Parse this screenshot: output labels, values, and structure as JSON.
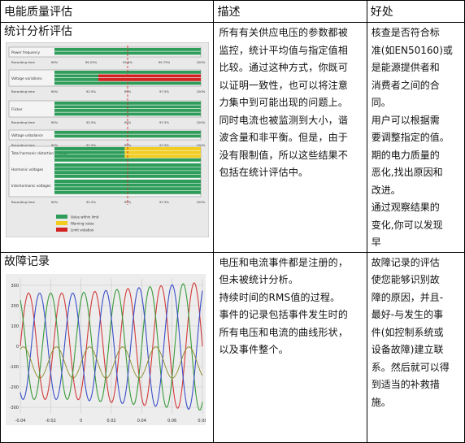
{
  "headers": {
    "col1": "电能质量评估",
    "col2": "描述",
    "col3": "好处"
  },
  "rows": [
    {
      "title": "统计分析评估",
      "description": [
        "所有有关供应电压的参数都被",
        "监控，统计平均值与指定值相",
        "比较。通过这种方式，你既可",
        "以证明一致性，也可以将注意",
        "力集中到可能出现的问题上。",
        "同时电流也被监测到大小，谐",
        "波含量和非平衡。但是，由于",
        "没有限制值，所以这些结果不",
        "包括在统计评估中。"
      ],
      "benefit": [
        "核查是否符合标",
        "准(如EN50160)或",
        "是能源提供者和",
        "消费者之间的合",
        "同。",
        "用户可以根据需",
        "要调整指定的值。",
        "期的电力质量的",
        "恶化,找出原因和",
        "改进。",
        "通过观察结果的",
        "变化,你可以发现",
        "早"
      ]
    },
    {
      "title": "故障记录",
      "description": [
        "电压和电流事件都是注册的，",
        "但未被统计分析。",
        "持续时间的RMS值的过程。",
        "事件的记录包括事件发生时的",
        "所有电压和电流的曲线形状，",
        "以及事件整个。"
      ],
      "benefit": [
        "故障记录的评估",
        "使您能够识别故",
        "障的原因，并且-",
        "最好-与发生的事",
        "件(如控制系统或",
        "设备故障)建立联",
        "系。然后就可以得",
        "到适当的补救措",
        "施。"
      ]
    }
  ],
  "stats_chart": {
    "bar_labels": [
      "Power frequency",
      "Voltage variations",
      "Flicker",
      "Voltage unbalance",
      "Total harmonic distortion voltage",
      "Harmonic voltages",
      "Interharmonic voltages"
    ],
    "axis_caption": "Recording time",
    "axis_ticks_a": [
      "99%",
      "99.25%",
      "99.5%",
      "99.75%",
      "100%"
    ],
    "axis_ticks_b": [
      "90%",
      "92.5%",
      "95%",
      "97.5%",
      "100%"
    ],
    "legend": [
      {
        "label": "Value within limit",
        "color": "#2e9d5a"
      },
      {
        "label": "Warning value",
        "color": "#f2cc1e"
      },
      {
        "label": "Limit violation",
        "color": "#d32222"
      }
    ]
  },
  "waveform_chart": {
    "x_ticks": [
      "-0.04",
      "-0.02",
      "0",
      "0.02",
      "0.04",
      "0.06",
      "0.08"
    ],
    "y_ticks": [
      "300",
      "200",
      "100",
      "0",
      "-100",
      "-200",
      "-300"
    ],
    "colors": {
      "red": "#d23a3a",
      "green": "#3a9a3a",
      "blue": "#3a4fc8",
      "olive": "#8a8a2a"
    }
  }
}
